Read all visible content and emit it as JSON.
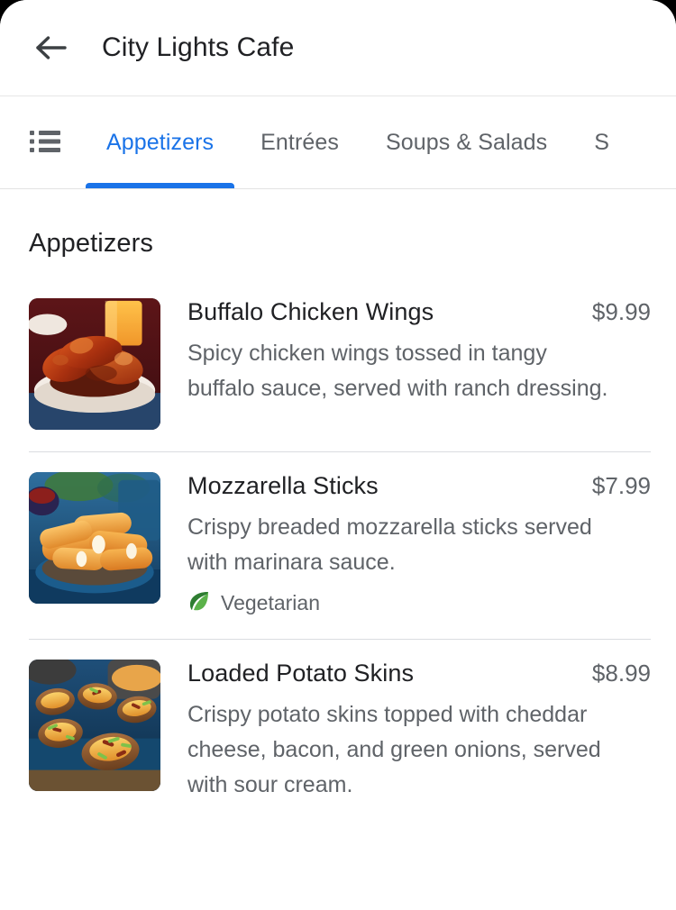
{
  "header": {
    "back_icon": "arrow-left-icon",
    "title": "City Lights Cafe"
  },
  "tabbar": {
    "list_icon": "list-view-icon",
    "active_tab": "Appetizers",
    "tabs": [
      {
        "label": "Appetizers",
        "active": true
      },
      {
        "label": "Entrées",
        "active": false
      },
      {
        "label": "Soups & Salads",
        "active": false
      },
      {
        "label": "S",
        "active": false
      }
    ]
  },
  "section": {
    "title": "Appetizers"
  },
  "menu": {
    "items": [
      {
        "name": "Buffalo Chicken Wings",
        "price": "$9.99",
        "description": "Spicy chicken wings tossed in tangy buffalo sauce, served with ranch dressing.",
        "image_alt": "buffalo-chicken-wings-photo",
        "tags": []
      },
      {
        "name": "Mozzarella Sticks",
        "price": "$7.99",
        "description": "Crispy breaded mozzarella sticks served with marinara sauce.",
        "image_alt": "mozzarella-sticks-photo",
        "tags": [
          {
            "icon": "leaf-icon",
            "label": "Vegetarian"
          }
        ]
      },
      {
        "name": "Loaded Potato Skins",
        "price": "$8.99",
        "description": "Crispy potato skins topped with cheddar cheese, bacon, and green onions, served with sour cream.",
        "image_alt": "loaded-potato-skins-photo",
        "tags": []
      }
    ]
  },
  "colors": {
    "accent": "#1a73e8",
    "text_primary": "#202124",
    "text_secondary": "#5f6368",
    "divider": "#dadce0",
    "background": "#ffffff"
  }
}
